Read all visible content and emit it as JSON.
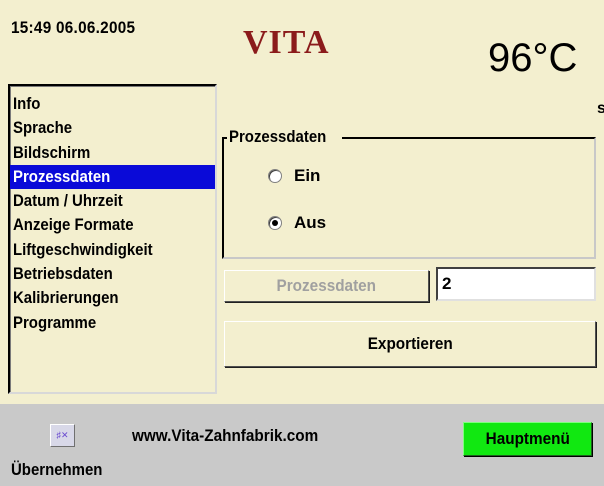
{
  "header": {
    "datetime": "15:49  06.06.2005",
    "logo": "VITA",
    "temperature": "96°C"
  },
  "menu": {
    "items": [
      {
        "label": "Info",
        "selected": false
      },
      {
        "label": "Sprache",
        "selected": false
      },
      {
        "label": "Bildschirm",
        "selected": false
      },
      {
        "label": "Prozessdaten",
        "selected": true
      },
      {
        "label": "Datum / Uhrzeit",
        "selected": false
      },
      {
        "label": "Anzeige Formate",
        "selected": false
      },
      {
        "label": "Liftgeschwindigkeit",
        "selected": false
      },
      {
        "label": "Betriebsdaten",
        "selected": false
      },
      {
        "label": "Kalibrierungen",
        "selected": false
      },
      {
        "label": "Programme",
        "selected": false
      }
    ]
  },
  "process_group": {
    "title": "Prozessdaten",
    "options": [
      {
        "label": "Ein",
        "checked": false
      },
      {
        "label": "Aus",
        "checked": true
      }
    ]
  },
  "right_edge_mark": "s",
  "process_button": {
    "label": "Prozessdaten",
    "enabled": false
  },
  "process_value": "2",
  "export_button": {
    "label": "Exportieren"
  },
  "footer": {
    "language_icon": "language-flag-icon",
    "url": "www.Vita-Zahnfabrik.com",
    "home_button": "Hauptmenü",
    "apply_label": "Übernehmen"
  },
  "colors": {
    "background": "#f3efcf",
    "selection": "#0a0ad8",
    "logo": "#8b1b1b",
    "home_button": "#11e811",
    "footer": "#c9c9c9"
  }
}
